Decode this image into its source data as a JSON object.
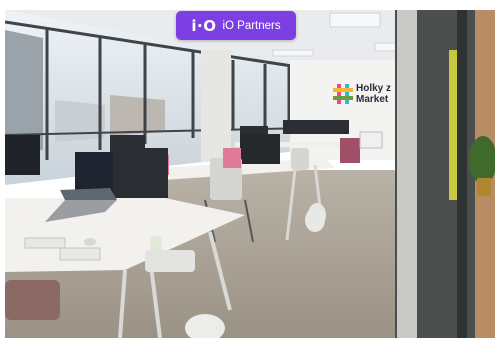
{
  "badge": {
    "logo": "i·O",
    "label": "iO Partners"
  },
  "wall_sign": {
    "line1": "Holky z",
    "line2": "Market"
  },
  "colors": {
    "badge_bg": "#7b3fe4",
    "badge_text": "#ffffff",
    "floor": "#a79f92",
    "ceiling": "#e9ebee",
    "desk": "#f2f1ee",
    "glass_partition": "#4a4f4d"
  }
}
